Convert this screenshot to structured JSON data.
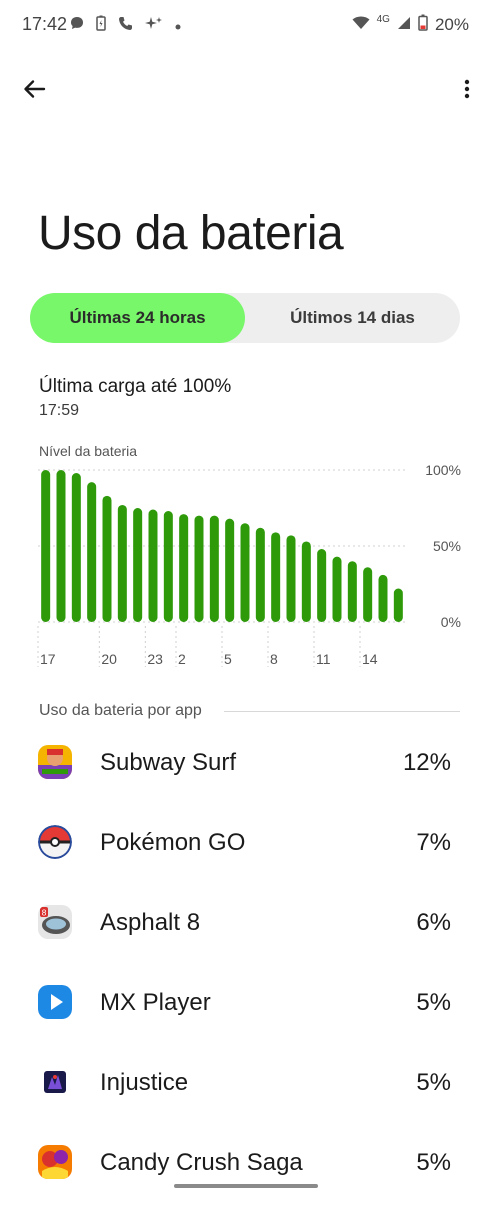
{
  "status_bar": {
    "time": "17:42",
    "network": "4G",
    "battery": "20%"
  },
  "page": {
    "title": "Uso da bateria"
  },
  "tabs": [
    {
      "label": "Últimas 24 horas",
      "active": true
    },
    {
      "label": "Últimos 14 dias",
      "active": false
    }
  ],
  "last_charge": {
    "title": "Última carga até 100%",
    "time": "17:59"
  },
  "chart_data": {
    "type": "bar",
    "title": "Nível da bateria",
    "categories": [
      "17",
      "",
      "",
      "",
      "20",
      "",
      "",
      "23",
      "",
      "2",
      "",
      "",
      "5",
      "",
      "",
      "8",
      "",
      "",
      "11",
      "",
      "",
      "14",
      "",
      ""
    ],
    "values": [
      100,
      100,
      98,
      92,
      83,
      77,
      75,
      74,
      73,
      71,
      70,
      70,
      68,
      65,
      62,
      59,
      57,
      53,
      48,
      43,
      40,
      36,
      31,
      22
    ],
    "y_tick_labels": [
      "100%",
      "50%",
      "0%"
    ],
    "ylim": [
      0,
      100
    ],
    "bar_color": "#2e9a0a"
  },
  "section": {
    "label": "Uso da bateria por app"
  },
  "apps": [
    {
      "name": "Subway Surf",
      "percent": "12%",
      "icon": "subway-surf-icon"
    },
    {
      "name": "Pokémon GO",
      "percent": "7%",
      "icon": "pokemon-go-icon"
    },
    {
      "name": "Asphalt 8",
      "percent": "6%",
      "icon": "asphalt-8-icon"
    },
    {
      "name": "MX Player",
      "percent": "5%",
      "icon": "mx-player-icon"
    },
    {
      "name": "Injustice",
      "percent": "5%",
      "icon": "injustice-icon"
    },
    {
      "name": "Candy Crush Saga",
      "percent": "5%",
      "icon": "candy-crush-icon"
    }
  ]
}
